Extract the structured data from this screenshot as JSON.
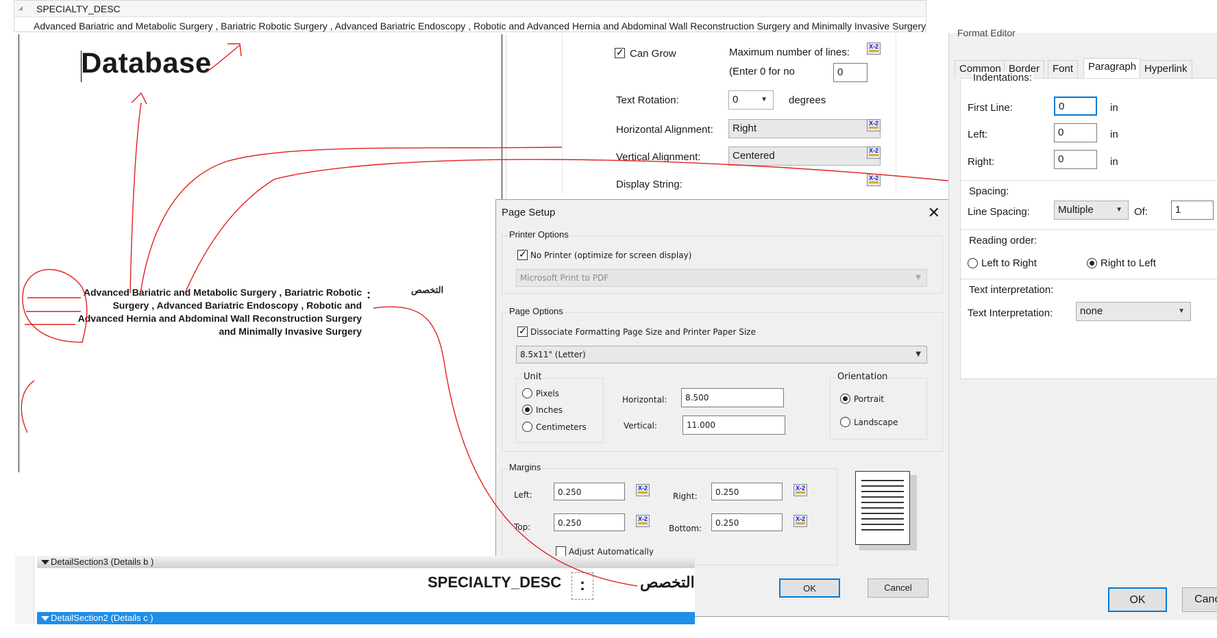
{
  "field_editor": {
    "name": "SPECIALTY_DESC",
    "value": "Advanced Bariatric and Metabolic Surgery , Bariatric Robotic Surgery , Advanced Bariatric Endoscopy , Robotic and Advanced Hernia and Abdominal Wall Reconstruction Surgery and Minimally Invasive Surgery"
  },
  "report_preview": {
    "title": "Database",
    "specialty_lines": [
      "Advanced Bariatric and Metabolic Surgery , Bariatric Robotic",
      "Surgery , Advanced Bariatric Endoscopy , Robotic and",
      "Advanced Hernia and Abdominal Wall Reconstruction Surgery",
      "and Minimally Invasive Surgery"
    ],
    "colon": ":",
    "arabic_label": "التخصص"
  },
  "properties": {
    "can_grow_label": "Can Grow",
    "can_grow_checked": true,
    "max_lines_label": "Maximum number of lines:",
    "max_lines_hint": "(Enter 0 for no",
    "max_lines_value": "0",
    "text_rotation_label": "Text Rotation:",
    "text_rotation_value": "0",
    "text_rotation_unit": "degrees",
    "h_align_label": "Horizontal Alignment:",
    "h_align_value": "Right",
    "v_align_label": "Vertical Alignment:",
    "v_align_value": "Centered",
    "display_string_label": "Display String:",
    "formula_button": "X-2"
  },
  "page_setup": {
    "title": "Page Setup",
    "close": "✕",
    "printer_options_label": "Printer Options",
    "no_printer_label": "No Printer (optimize for screen display)",
    "no_printer_checked": true,
    "printer_value": "Microsoft Print to PDF",
    "page_options_label": "Page Options",
    "dissociate_label": "Dissociate Formatting Page Size and Printer Paper Size",
    "dissociate_checked": true,
    "paper_value": "8.5x11\" (Letter)",
    "unit_label": "Unit",
    "units": [
      "Pixels",
      "Inches",
      "Centimeters"
    ],
    "unit_selected": "Inches",
    "horizontal_label": "Horizontal:",
    "horizontal_value": "8.500",
    "vertical_label": "Vertical:",
    "vertical_value": "11.000",
    "orientation_label": "Orientation",
    "orientations": [
      "Portrait",
      "Landscape"
    ],
    "orientation_selected": "Portrait",
    "margins_label": "Margins",
    "left_label": "Left:",
    "left_value": "0.250",
    "right_label": "Right:",
    "right_value": "0.250",
    "top_label": "Top:",
    "top_value": "0.250",
    "bottom_label": "Bottom:",
    "bottom_value": "0.250",
    "adjust_label": "Adjust Automatically",
    "adjust_checked": false,
    "ok": "OK",
    "cancel": "Cancel"
  },
  "format_editor": {
    "title": "Format Editor",
    "tabs": [
      "Common",
      "Border",
      "Font",
      "Paragraph",
      "Hyperlink"
    ],
    "active_tab": "Paragraph",
    "indentations_label": "Indentations:",
    "first_line_label": "First Line:",
    "first_line_value": "0",
    "left_label": "Left:",
    "left_value": "0",
    "right_label": "Right:",
    "right_value": "0",
    "unit": "in",
    "spacing_label": "Spacing:",
    "line_spacing_label": "Line Spacing:",
    "line_spacing_value": "Multiple",
    "of_label": "Of:",
    "of_value": "1",
    "reading_order_label": "Reading order:",
    "ltr_label": "Left to Right",
    "rtl_label": "Right to Left",
    "reading_order_selected": "Right to Left",
    "text_interp_group": "Text interpretation:",
    "text_interp_label": "Text Interpretation:",
    "text_interp_value": "none",
    "ok": "OK",
    "cancel": "Cancel"
  },
  "design_sections": {
    "section3": "DetailSection3 (Details b )",
    "field": "SPECIALTY_DESC",
    "colon": ":",
    "arabic_label": "التخصص",
    "section2": "DetailSection2 (Details c )"
  },
  "colors": {
    "annotation_red": "#e0201c",
    "selection_blue": "#1f8fe8",
    "focus_blue": "#0078d7"
  }
}
